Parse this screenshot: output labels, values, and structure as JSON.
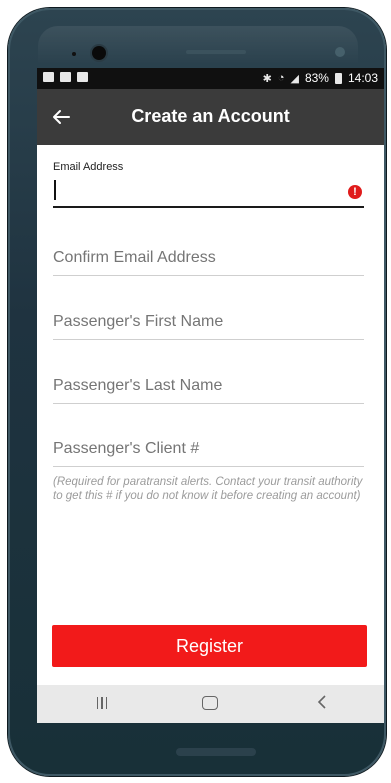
{
  "status_bar": {
    "battery_percent": "83%",
    "time": "14:03"
  },
  "app_bar": {
    "title": "Create an Account",
    "back_icon": "arrow-left-icon"
  },
  "form": {
    "email": {
      "label": "Email Address",
      "value": "",
      "error_icon": "alert-circle-icon"
    },
    "confirm_email": {
      "placeholder": "Confirm Email Address",
      "value": ""
    },
    "first_name": {
      "placeholder": "Passenger's First Name",
      "value": ""
    },
    "last_name": {
      "placeholder": "Passenger's Last Name",
      "value": ""
    },
    "client_number": {
      "placeholder": "Passenger's Client #",
      "value": ""
    },
    "client_help": "(Required for paratransit alerts. Contact your transit authority to get this # if you do not know it before creating an account)"
  },
  "actions": {
    "register_label": "Register"
  },
  "nav_bar": {
    "recent_icon": "recent-apps-icon",
    "home_icon": "home-icon",
    "back_icon": "back-nav-icon"
  },
  "colors": {
    "app_bar": "#3b3b3b",
    "register": "#f21a1a",
    "error": "#e01b1b"
  }
}
